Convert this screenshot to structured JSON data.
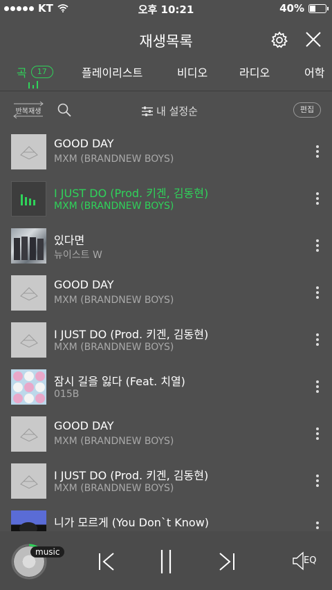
{
  "status_bar": {
    "carrier": "KT",
    "time": "오후 10:21",
    "battery": "40%",
    "battery_level": 0.4
  },
  "header": {
    "title": "재생목록"
  },
  "tabs": [
    {
      "label": "곡",
      "badge": "17",
      "active": true
    },
    {
      "label": "플레이리스트"
    },
    {
      "label": "비디오"
    },
    {
      "label": "라디오"
    },
    {
      "label": "어학"
    }
  ],
  "toolbar": {
    "repeat_label": "반복재생",
    "sort_label": "내 설정순",
    "edit_label": "편집"
  },
  "songs": [
    {
      "title": "GOOD DAY",
      "artist": "MXM (BRANDNEW BOYS)"
    },
    {
      "title": "I JUST DO (Prod. 키겐, 김동현)",
      "artist": "MXM (BRANDNEW BOYS)",
      "playing": true
    },
    {
      "title": "있다면",
      "artist": "뉴이스트 W"
    },
    {
      "title": "GOOD DAY",
      "artist": "MXM (BRANDNEW BOYS)"
    },
    {
      "title": "I JUST DO (Prod. 키겐, 김동현)",
      "artist": "MXM (BRANDNEW BOYS)"
    },
    {
      "title": "잠시 길을 잃다 (Feat. 치열)",
      "artist": "015B"
    },
    {
      "title": "GOOD DAY",
      "artist": "MXM (BRANDNEW BOYS)"
    },
    {
      "title": "I JUST DO (Prod. 키겐, 김동현)",
      "artist": "MXM (BRANDNEW BOYS)"
    },
    {
      "title": "니가 모르게 (You Don`t Know)",
      "artist": ""
    }
  ],
  "player": {
    "music_tag": "music",
    "eq_label": "EQ"
  },
  "colors": {
    "accent": "#2fd35a",
    "background": "#4f4f4f"
  }
}
